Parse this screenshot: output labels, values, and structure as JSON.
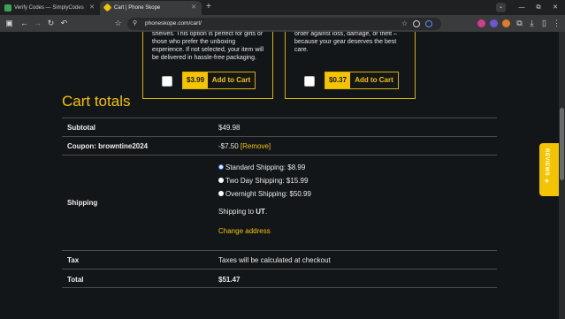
{
  "browser": {
    "tabs": [
      {
        "title": "Verify Codes — SimplyCodes",
        "active": false
      },
      {
        "title": "Cart | Phone Skope",
        "active": true
      }
    ],
    "new_tab": "+",
    "url": "phoneskope.com/cart/",
    "window_controls": [
      "—",
      "⧉",
      "✕"
    ]
  },
  "page": {
    "offers": [
      {
        "description": "shelves. This option is perfect for gifts or those who prefer the unboxing experience. If not selected, your item will be delivered in hassle-free packaging.",
        "price": "$3.99",
        "add_label": "Add to Cart"
      },
      {
        "description": "Shipping Protection: Safeguard your order against loss, damage, or theft – because your gear deserves the best care.",
        "price": "$0.37",
        "add_label": "Add to Cart"
      }
    ],
    "cart_totals": {
      "title": "Cart totals",
      "subtotal_label": "Subtotal",
      "subtotal_value": "$49.98",
      "coupon_label": "Coupon: browntine2024",
      "coupon_value": "-$7.50",
      "coupon_remove": "[Remove]",
      "shipping_label": "Shipping",
      "shipping_options": [
        {
          "label": "Standard Shipping: $8.99",
          "selected": true
        },
        {
          "label": "Two Day Shipping: $15.99",
          "selected": false
        },
        {
          "label": "Overnight Shipping: $50.99",
          "selected": false
        }
      ],
      "ship_to_prefix": "Shipping to ",
      "ship_to_state": "UT",
      "ship_to_suffix": ".",
      "change_address": "Change address",
      "tax_label": "Tax",
      "tax_value": "Taxes will be calculated at checkout",
      "total_label": "Total",
      "total_value": "$51.47"
    },
    "reviews_tab": "REVIEWS ★",
    "accent_color": "#f5c400"
  }
}
